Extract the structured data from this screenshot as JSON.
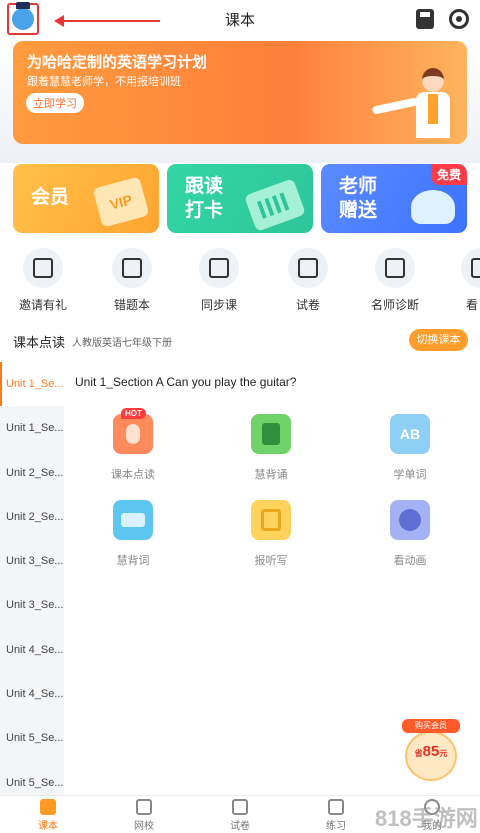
{
  "header": {
    "title": "课本",
    "avatar_icon": "user-avatar-icon",
    "save_icon": "download-icon",
    "service_icon": "headset-icon"
  },
  "banner": {
    "title": "为哈哈定制的英语学习计划",
    "subtitle": "跟着慧慧老师学，不用报培训班",
    "button": "立即学习"
  },
  "cards": {
    "vip": "会员",
    "vip_badge": "VIP",
    "read_line1": "跟读",
    "read_line2": "打卡",
    "teacher_line1": "老师",
    "teacher_line2": "赠送",
    "free_tag": "免费"
  },
  "quick_nav": [
    {
      "label": "邀请有礼",
      "icon": "gift-icon"
    },
    {
      "label": "错题本",
      "icon": "notebook-icon"
    },
    {
      "label": "同步课",
      "icon": "video-play-icon"
    },
    {
      "label": "试卷",
      "icon": "exam-paper-icon"
    },
    {
      "label": "名师诊断",
      "icon": "diagnosis-icon"
    },
    {
      "label": "看",
      "icon": "watch-icon"
    }
  ],
  "textbook": {
    "title": "课本点读",
    "book": "人教版英语七年级下册",
    "switch": "切换课本"
  },
  "units": [
    "Unit 1_Se...",
    "Unit 1_Se...",
    "Unit 2_Se...",
    "Unit 2_Se...",
    "Unit 3_Se...",
    "Unit 3_Se...",
    "Unit 4_Se...",
    "Unit 4_Se...",
    "Unit 5_Se...",
    "Unit 5_Se..."
  ],
  "lesson": {
    "title": "Unit 1_Section A Can you play the guitar?",
    "hot_tag": "HOT",
    "features": [
      {
        "label": "课本点读",
        "icon": "read-finger-icon",
        "color": "#ff8a5c"
      },
      {
        "label": "慧背诵",
        "icon": "book-icon",
        "color": "#6fd36a"
      },
      {
        "label": "学单词",
        "icon": "ab-letters-icon",
        "color": "#8ed0f5",
        "glyph": "AB"
      },
      {
        "label": "慧背词",
        "icon": "word-cards-icon",
        "color": "#5cc6f0"
      },
      {
        "label": "报听写",
        "icon": "dictation-icon",
        "color": "#ffd25e"
      },
      {
        "label": "看动画",
        "icon": "film-reel-icon",
        "color": "#a4b2f5"
      }
    ]
  },
  "promo": {
    "tag": "购买会员",
    "prefix": "省",
    "amount": "85",
    "suffix": "元"
  },
  "bottom_nav": [
    {
      "label": "课本",
      "active": true
    },
    {
      "label": "网校",
      "active": false
    },
    {
      "label": "试卷",
      "active": false
    },
    {
      "label": "练习",
      "active": false
    },
    {
      "label": "我的",
      "active": false
    }
  ],
  "watermark": "818手游网"
}
